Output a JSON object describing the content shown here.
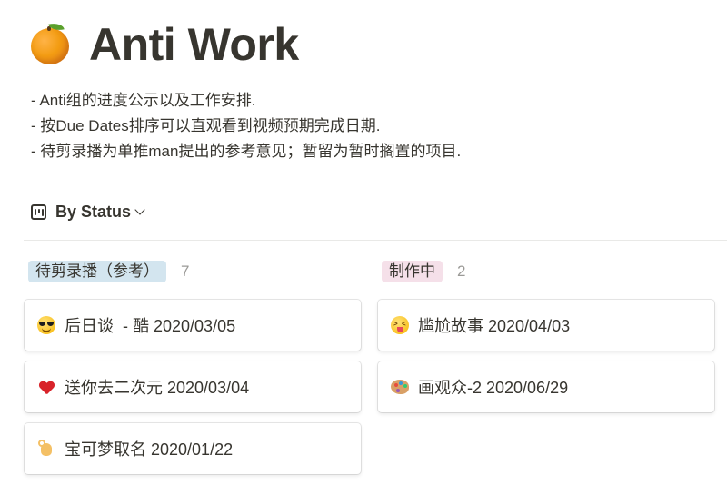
{
  "page": {
    "icon": "orange-icon",
    "title": "Anti Work",
    "description": [
      "- Anti组的进度公示以及工作安排.",
      "- 按Due Dates排序可以直观看到视频预期完成日期.",
      "- 待剪录播为单推man提出的参考意见；暂留为暂时搁置的项目."
    ]
  },
  "view": {
    "icon": "board-icon",
    "label": "By Status"
  },
  "board": {
    "columns": [
      {
        "status": "待剪录播（参考）",
        "count": "7",
        "tag_color": "#d3e5ef",
        "cards": [
          {
            "emoji": "sunglasses-face-icon",
            "title": "后日谈  - 酷 2020/03/05"
          },
          {
            "emoji": "red-heart-icon",
            "title": "送你去二次元 2020/03/04"
          },
          {
            "emoji": "ok-hand-icon",
            "title": "宝可梦取名 2020/01/22"
          }
        ]
      },
      {
        "status": "制作中",
        "count": "2",
        "tag_color": "#f5e0e9",
        "cards": [
          {
            "emoji": "zany-face-icon",
            "title": "尴尬故事 2020/04/03"
          },
          {
            "emoji": "artist-palette-icon",
            "title": "画观众-2 2020/06/29"
          }
        ]
      }
    ]
  }
}
